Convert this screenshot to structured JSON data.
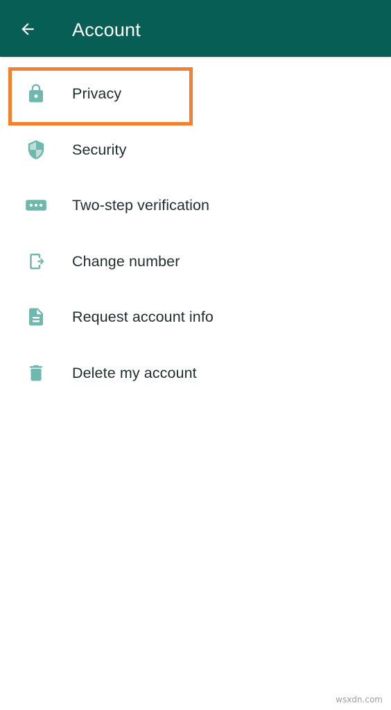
{
  "appbar": {
    "title": "Account",
    "back_icon": "arrow-left-icon",
    "background": "#075e54"
  },
  "menu": {
    "icon_color": "#6fb8ad",
    "items": [
      {
        "label": "Privacy",
        "icon": "lock-icon"
      },
      {
        "label": "Security",
        "icon": "shield-icon"
      },
      {
        "label": "Two-step verification",
        "icon": "dots-keypad-icon"
      },
      {
        "label": "Change number",
        "icon": "phone-swap-icon"
      },
      {
        "label": "Request account info",
        "icon": "document-icon"
      },
      {
        "label": "Delete my account",
        "icon": "trash-icon"
      }
    ]
  },
  "highlight": {
    "target": "Privacy",
    "color": "#f47f2c"
  },
  "watermark": {
    "text": "wsxdn.com"
  }
}
